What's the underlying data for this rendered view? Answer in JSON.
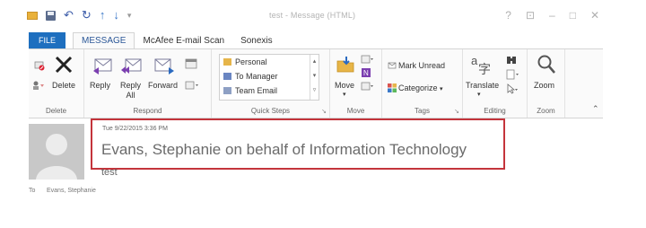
{
  "window": {
    "title": "test - Message (HTML)",
    "controls": [
      "?",
      "⊡",
      "–",
      "□",
      "✕"
    ]
  },
  "quick_access": {
    "icons": [
      "mail-icon",
      "save-icon",
      "undo-icon",
      "redo-icon",
      "up-arrow-icon",
      "down-arrow-icon",
      "customize-icon"
    ]
  },
  "tabs": [
    {
      "label": "FILE",
      "active": false
    },
    {
      "label": "MESSAGE",
      "active": true
    },
    {
      "label": "McAfee E-mail Scan",
      "active": false
    },
    {
      "label": "Sonexis",
      "active": false
    }
  ],
  "ribbon": {
    "delete_group": {
      "label": "Delete",
      "delete_button": "Delete"
    },
    "respond_group": {
      "label": "Respond",
      "reply": "Reply",
      "reply_all_line1": "Reply",
      "reply_all_line2": "All",
      "forward": "Forward"
    },
    "quick_steps": {
      "label": "Quick Steps",
      "items": [
        "Personal",
        "To Manager",
        "Team Email"
      ]
    },
    "move_group": {
      "label": "Move",
      "move_button": "Move"
    },
    "tags_group": {
      "label": "Tags",
      "mark_unread": "Mark Unread",
      "categorize": "Categorize"
    },
    "editing_group": {
      "label": "Editing",
      "translate": "Translate"
    },
    "zoom_group": {
      "label": "Zoom",
      "zoom_button": "Zoom"
    }
  },
  "message": {
    "date": "Tue 9/22/2015 3:36 PM",
    "sender": "Evans, Stephanie on behalf of Information Technology",
    "subject": "test",
    "to_label": "To",
    "to_value": "Evans, Stephanie"
  },
  "colors": {
    "file_tab": "#1e6fbf",
    "highlight_border": "#c4343b",
    "accent": "#2b5797"
  }
}
